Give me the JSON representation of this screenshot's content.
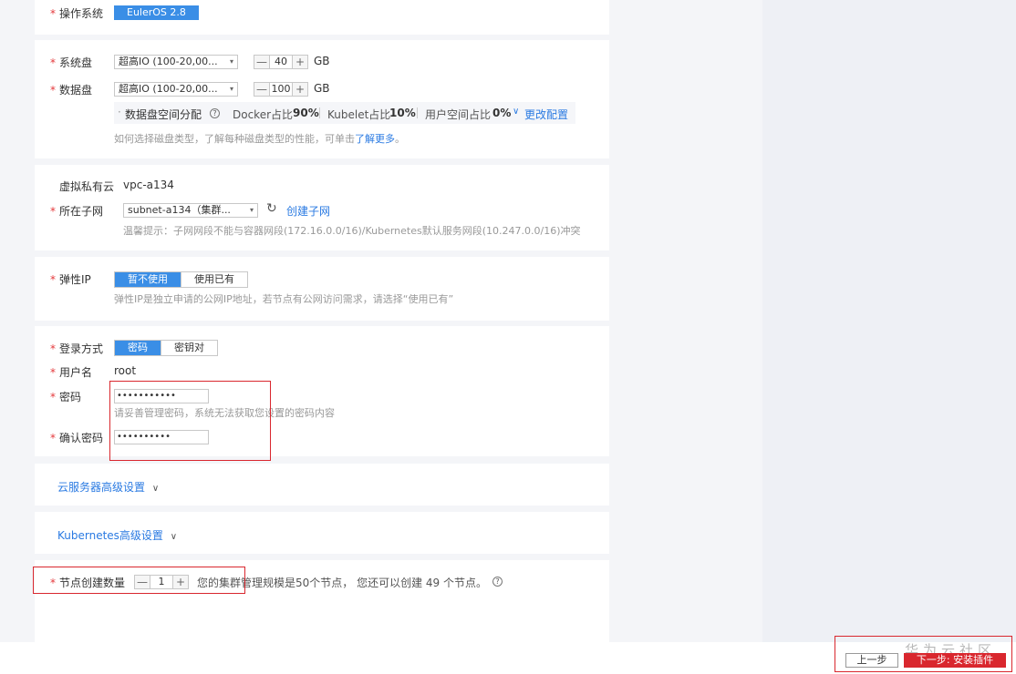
{
  "os": {
    "label": "操作系统",
    "value": "EulerOS 2.8"
  },
  "disk": {
    "system_label": "系统盘",
    "system_type": "超高IO (100-20,00...",
    "system_size": "40",
    "data_label": "数据盘",
    "data_type": "超高IO (100-20,00...",
    "data_size": "100",
    "unit": "GB",
    "minus": "—",
    "plus": "+",
    "alloc_label": "数据盘空间分配",
    "docker_label": "Docker占比",
    "docker_value": "90%",
    "kubelet_label": "Kubelet占比",
    "kubelet_value": "10%",
    "user_label": "用户空间占比",
    "user_value": "0%",
    "change_config": "更改配置",
    "hint_prefix": "如何选择磁盘类型，了解每种磁盘类型的性能，可单击",
    "hint_link": "了解更多",
    "hint_suffix": "。"
  },
  "network": {
    "vpc_label": "虚拟私有云",
    "vpc_value": "vpc-a134",
    "subnet_label": "所在子网",
    "subnet_value": "subnet-a134（集群...",
    "create_subnet": "创建子网",
    "hint": "温馨提示：子网网段不能与容器网段(172.16.0.0/16)/Kubernetes默认服务网段(10.247.0.0/16)冲突"
  },
  "eip": {
    "label": "弹性IP",
    "opt_none": "暂不使用",
    "opt_existing": "使用已有",
    "hint": "弹性IP是独立申请的公网IP地址，若节点有公网访问需求，请选择“使用已有”"
  },
  "login": {
    "method_label": "登录方式",
    "opt_password": "密码",
    "opt_key": "密钥对",
    "user_label": "用户名",
    "user_value": "root",
    "password_label": "密码",
    "password_value": "•••••••••••",
    "password_hint": "请妥善管理密码，系统无法获取您设置的密码内容",
    "confirm_label": "确认密码",
    "confirm_value": "••••••••••"
  },
  "advanced": {
    "ecs": "云服务器高级设置",
    "k8s": "Kubernetes高级设置"
  },
  "nodes": {
    "label": "节点创建数量",
    "value": "1",
    "info": "您的集群管理规模是50个节点，  您还可以创建 49 个节点。"
  },
  "footer": {
    "prev": "上一步",
    "next": "下一步: 安装插件",
    "watermark": "华为云社区"
  },
  "colors": {
    "accent": "#3a8ee6",
    "danger": "#d9272e",
    "link": "#2a7ae2"
  }
}
